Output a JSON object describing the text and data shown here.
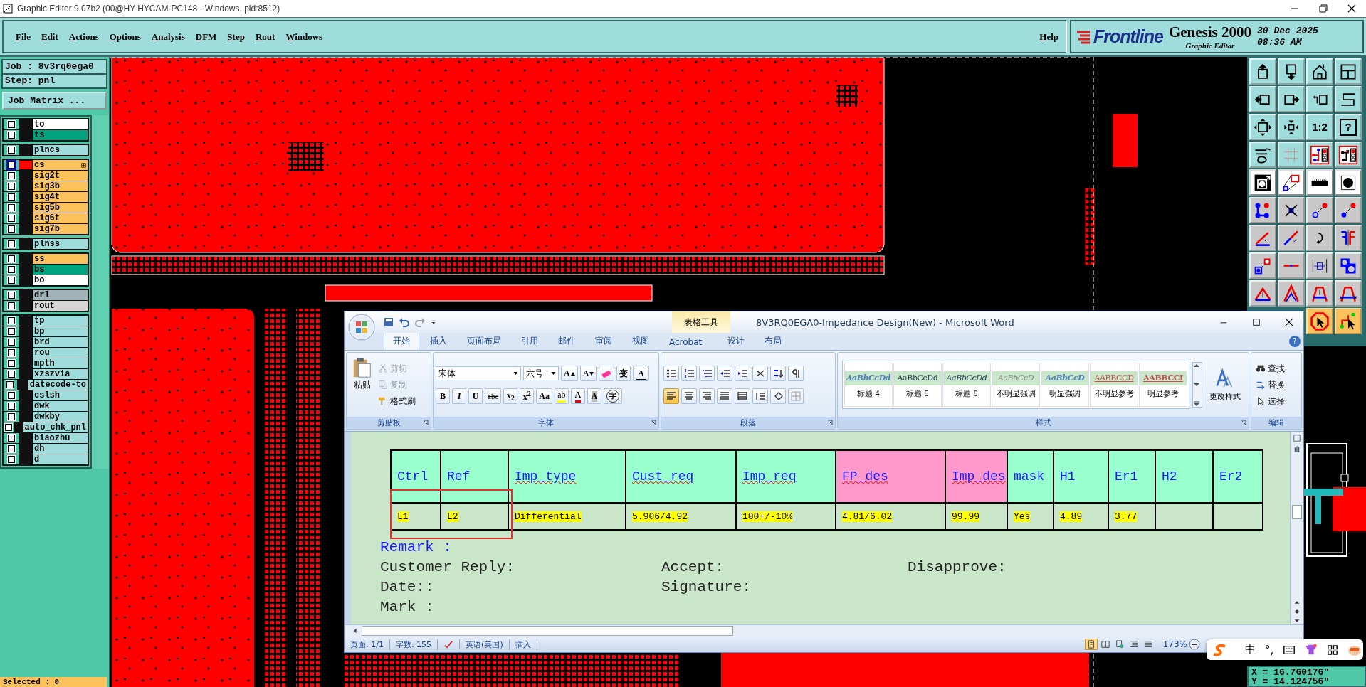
{
  "window": {
    "title": "Graphic Editor 9.07b2 (00@HY-HYCAM-PC148 - Windows, pid:8512)"
  },
  "menu": [
    {
      "label": "File"
    },
    {
      "label": "Edit"
    },
    {
      "label": "Actions"
    },
    {
      "label": "Options"
    },
    {
      "label": "Analysis"
    },
    {
      "label": "DFM"
    },
    {
      "label": "Step"
    },
    {
      "label": "Rout"
    },
    {
      "label": "Windows"
    }
  ],
  "help": "Help",
  "brand": {
    "logo": "Frontline",
    "product": "Genesis 2000",
    "subtitle": "Graphic Editor",
    "date": "30 Dec 2025",
    "time": "08:36 AM"
  },
  "job": {
    "job": "Job : 8v3rq0ega0",
    "step": "Step: pnl",
    "matrix_button": "Job Matrix ..."
  },
  "layer_groups": [
    [
      {
        "name": "to",
        "color": "#ffffff",
        "checked": false,
        "selected": false
      },
      {
        "name": "ts",
        "color": "#00a37e",
        "checked": false,
        "selected": false
      }
    ],
    [
      {
        "name": "plncs",
        "color": "#9fdcdc",
        "checked": false,
        "selected": false
      }
    ],
    [
      {
        "name": "cs",
        "color": "#fbc15a",
        "checked": false,
        "selected": true
      },
      {
        "name": "sig2t",
        "color": "#fbc15a",
        "checked": false,
        "selected": false
      },
      {
        "name": "sig3b",
        "color": "#fbc15a",
        "checked": false,
        "selected": false
      },
      {
        "name": "sig4t",
        "color": "#fbc15a",
        "checked": false,
        "selected": false
      },
      {
        "name": "sig5b",
        "color": "#fbc15a",
        "checked": false,
        "selected": false
      },
      {
        "name": "sig6t",
        "color": "#fbc15a",
        "checked": false,
        "selected": false
      },
      {
        "name": "sig7b",
        "color": "#fbc15a",
        "checked": false,
        "selected": false
      }
    ],
    [
      {
        "name": "plnss",
        "color": "#9fdcdc",
        "checked": false,
        "selected": false
      }
    ],
    [
      {
        "name": "ss",
        "color": "#fbc15a",
        "checked": false,
        "selected": false
      },
      {
        "name": "bs",
        "color": "#00a37e",
        "checked": false,
        "selected": false
      },
      {
        "name": "bo",
        "color": "#ffffff",
        "checked": false,
        "selected": false
      }
    ],
    [
      {
        "name": "drl",
        "color": "#9fb3b8",
        "checked": false,
        "selected": false
      },
      {
        "name": "rout",
        "color": "#d6d6d6",
        "checked": false,
        "selected": false
      }
    ],
    [
      {
        "name": "tp",
        "color": "#9fdcdc",
        "checked": false,
        "selected": false
      },
      {
        "name": "bp",
        "color": "#9fdcdc",
        "checked": false,
        "selected": false
      },
      {
        "name": "brd",
        "color": "#9fdcdc",
        "checked": false,
        "selected": false
      },
      {
        "name": "rou",
        "color": "#9fdcdc",
        "checked": false,
        "selected": false
      },
      {
        "name": "mpth",
        "color": "#9fdcdc",
        "checked": false,
        "selected": false
      },
      {
        "name": "xzszvia",
        "color": "#9fdcdc",
        "checked": false,
        "selected": false
      },
      {
        "name": "datecode-to",
        "color": "#9fdcdc",
        "checked": false,
        "selected": false
      },
      {
        "name": "cslsh",
        "color": "#9fdcdc",
        "checked": false,
        "selected": false
      },
      {
        "name": "dwk",
        "color": "#9fdcdc",
        "checked": false,
        "selected": false
      },
      {
        "name": "dwkby",
        "color": "#9fdcdc",
        "checked": false,
        "selected": false
      },
      {
        "name": "auto_chk_pnl",
        "color": "#9fdcdc",
        "checked": false,
        "selected": false
      },
      {
        "name": "biaozhu",
        "color": "#9fdcdc",
        "checked": false,
        "selected": false
      },
      {
        "name": "dh",
        "color": "#9fdcdc",
        "checked": false,
        "selected": false
      },
      {
        "name": "d",
        "color": "#9fdcdc",
        "checked": false,
        "selected": false
      }
    ]
  ],
  "selected_count": "Selected : 0",
  "toolbar": {
    "labels": [
      "1:2",
      "?"
    ]
  },
  "coords": {
    "x": "X = 16.760176\"",
    "y": "Y = 14.124756\""
  },
  "word": {
    "title": "8V3RQ0EGA0-Impedance Design(New) - Microsoft Word",
    "context_tab": "表格工具",
    "help": "?",
    "tabs": [
      {
        "label": "开始",
        "selected": true
      },
      {
        "label": "插入",
        "selected": false
      },
      {
        "label": "页面布局",
        "selected": false
      },
      {
        "label": "引用",
        "selected": false
      },
      {
        "label": "邮件",
        "selected": false
      },
      {
        "label": "审阅",
        "selected": false
      },
      {
        "label": "视图",
        "selected": false
      },
      {
        "label": "Acrobat",
        "selected": false
      },
      {
        "label": "设计",
        "selected": false
      },
      {
        "label": "布局",
        "selected": false
      }
    ],
    "clipboard": {
      "label": "剪贴板",
      "paste": "粘贴",
      "items": [
        {
          "label": "剪切",
          "disabled": true
        },
        {
          "label": "复制",
          "disabled": true
        },
        {
          "label": "格式刷",
          "disabled": false
        }
      ]
    },
    "font": {
      "label": "字体",
      "name": "宋体",
      "size": "六号",
      "row1": [
        {
          "kind": "grow",
          "label": "A"
        },
        {
          "kind": "shrink",
          "label": "A"
        },
        {
          "kind": "clear"
        },
        {
          "kind": "phonetic",
          "label": "变"
        },
        {
          "kind": "border",
          "label": "A"
        }
      ],
      "row2": [
        {
          "kind": "bold",
          "label": "B"
        },
        {
          "kind": "italic",
          "label": "I"
        },
        {
          "kind": "underline",
          "label": "U"
        },
        {
          "kind": "strike",
          "label": "abc"
        },
        {
          "kind": "script",
          "label": "x$_{2}$"
        },
        {
          "kind": "script",
          "label": "x$^{2}$"
        },
        {
          "kind": "case",
          "label": "Aa"
        },
        {
          "kind": "highlight",
          "label": "ab"
        },
        {
          "kind": "color",
          "label": "A"
        },
        {
          "kind": "shade",
          "label": "A"
        },
        {
          "kind": "enclose",
          "label": "字"
        }
      ]
    },
    "paragraph": {
      "label": "段落",
      "align": [
        {
          "selected": true
        },
        {
          "selected": false
        },
        {
          "selected": false
        },
        {
          "selected": false
        },
        {
          "selected": false
        }
      ]
    },
    "styles": {
      "label": "样式",
      "change": "更改样式",
      "items": [
        {
          "preview": "AaBbCcDd",
          "name": "标题 4",
          "kind": "heading"
        },
        {
          "preview": "AaBbCcDd",
          "name": "标题 5",
          "kind": "plain"
        },
        {
          "preview": "AaBbCcDd",
          "name": "标题 6",
          "kind": "heading-italic"
        },
        {
          "preview": "AaBbCcD",
          "name": "不明显强调",
          "kind": "subtle"
        },
        {
          "preview": "AaBbCcD",
          "name": "明显强调",
          "kind": "intense"
        },
        {
          "preview": "AABBCCD",
          "name": "不明显参考",
          "kind": "subtle-ref"
        },
        {
          "preview": "AABBCCI",
          "name": "明显参考",
          "kind": "intense-ref"
        }
      ]
    },
    "editing": {
      "label": "编辑",
      "items": [
        {
          "label": "查找",
          "kind": "find"
        },
        {
          "label": "替换",
          "kind": "replace"
        },
        {
          "label": "选择",
          "kind": "select"
        }
      ]
    },
    "table": {
      "columns": [
        {
          "label": "Ctrl",
          "color": "#99ffcc",
          "spell_error": false
        },
        {
          "label": "Ref",
          "color": "#99ffcc",
          "spell_error": false
        },
        {
          "label": "Imp_type",
          "color": "#99ffcc",
          "spell_error": true
        },
        {
          "label": "Cust_req",
          "color": "#99ffcc",
          "spell_error": true
        },
        {
          "label": "Imp_req",
          "color": "#99ffcc",
          "spell_error": true
        },
        {
          "label": "FP_des",
          "color": "#ff99cc",
          "spell_error": true
        },
        {
          "label": "Imp_des",
          "color": "#ff99cc",
          "spell_error": true
        },
        {
          "label": "mask",
          "color": "#99ffcc",
          "spell_error": false
        },
        {
          "label": "H1",
          "color": "#99ffcc",
          "spell_error": false
        },
        {
          "label": "Er1",
          "color": "#99ffcc",
          "spell_error": false
        },
        {
          "label": "H2",
          "color": "#99ffcc",
          "spell_error": false
        },
        {
          "label": "Er2",
          "color": "#99ffcc",
          "spell_error": false
        }
      ],
      "rows": [
        {
          "cells": [
            "L1",
            "L2",
            "Differential",
            "5.906/4.92",
            "100+/-10%",
            "4.81/6.02",
            "99.99",
            "Yes",
            "4.89",
            "3.77"
          ]
        }
      ]
    },
    "remark": "Remark :",
    "form": [
      [
        "Customer Reply:",
        "Accept:",
        "Disapprove:"
      ],
      [
        "Date::",
        "Signature:"
      ],
      [
        "Mark :"
      ]
    ],
    "status": {
      "page": "页面: 1/1",
      "words": "字数: 155",
      "language": "英语(美国)",
      "mode": "插入",
      "zoom": "173%"
    }
  },
  "ime": {
    "mode": "中",
    "punct": "°,"
  }
}
